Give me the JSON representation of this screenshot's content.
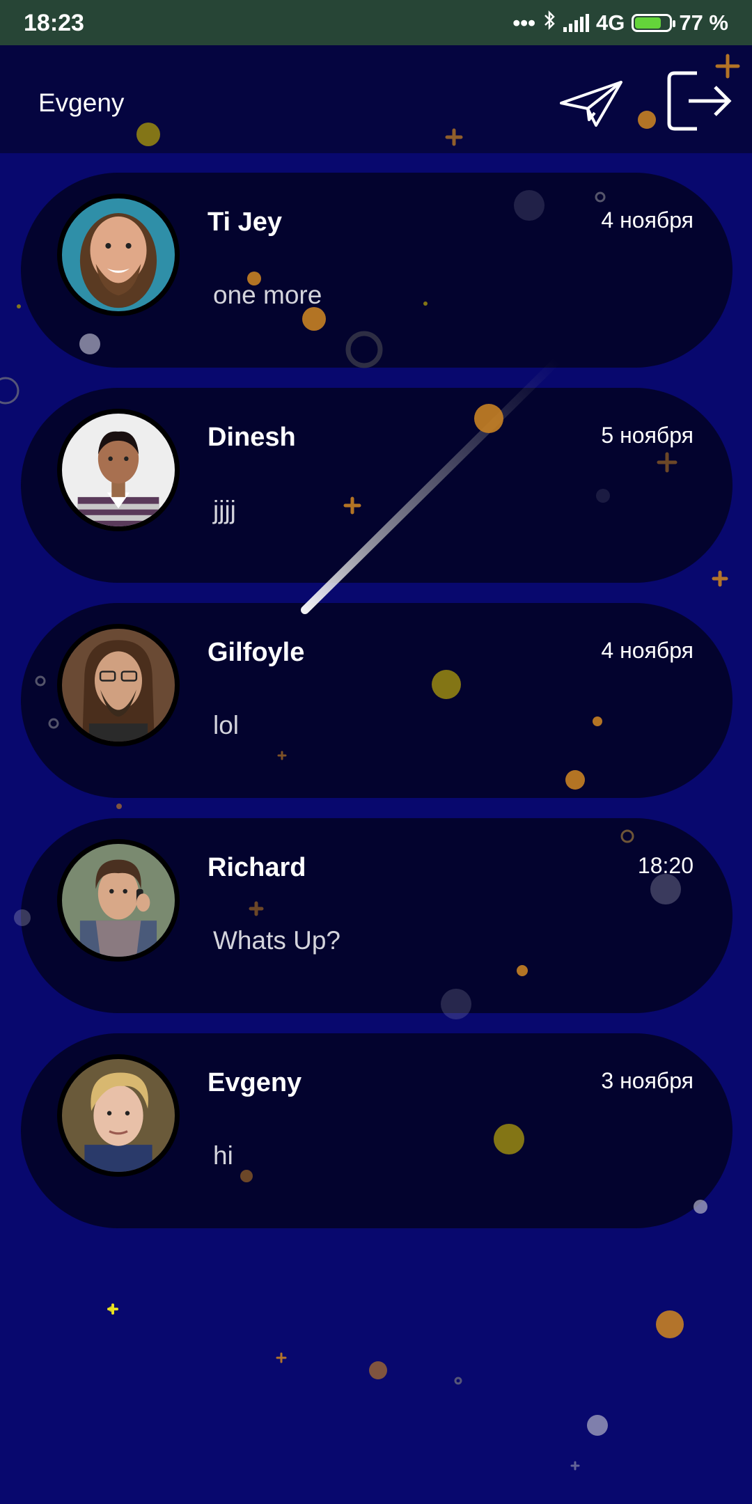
{
  "status_bar": {
    "time": "18:23",
    "dots": "•••",
    "network": "4G",
    "battery": "77 %",
    "battery_level": 0.77,
    "icons": [
      "bluetooth-icon",
      "signal-icon",
      "battery-charging-icon"
    ]
  },
  "app_bar": {
    "title": "Evgeny",
    "send_icon": "paper-plane-icon",
    "logout_icon": "logout-icon"
  },
  "colors": {
    "background": "#08086e",
    "app_bar": "#050540",
    "card": "#03032e",
    "status_bar": "#274536",
    "accent_orange": "#e0922a",
    "accent_yellow": "#9a8a10"
  },
  "chats": [
    {
      "name": "Ti Jey",
      "date": "4 ноября",
      "message": "one more"
    },
    {
      "name": "Dinesh",
      "date": "5 ноября",
      "message": "jjjj"
    },
    {
      "name": "Gilfoyle",
      "date": "4 ноября",
      "message": "lol"
    },
    {
      "name": "Richard",
      "date": "18:20",
      "message": "Whats Up?"
    },
    {
      "name": "Evgeny",
      "date": "3 ноября",
      "message": "hi"
    }
  ]
}
